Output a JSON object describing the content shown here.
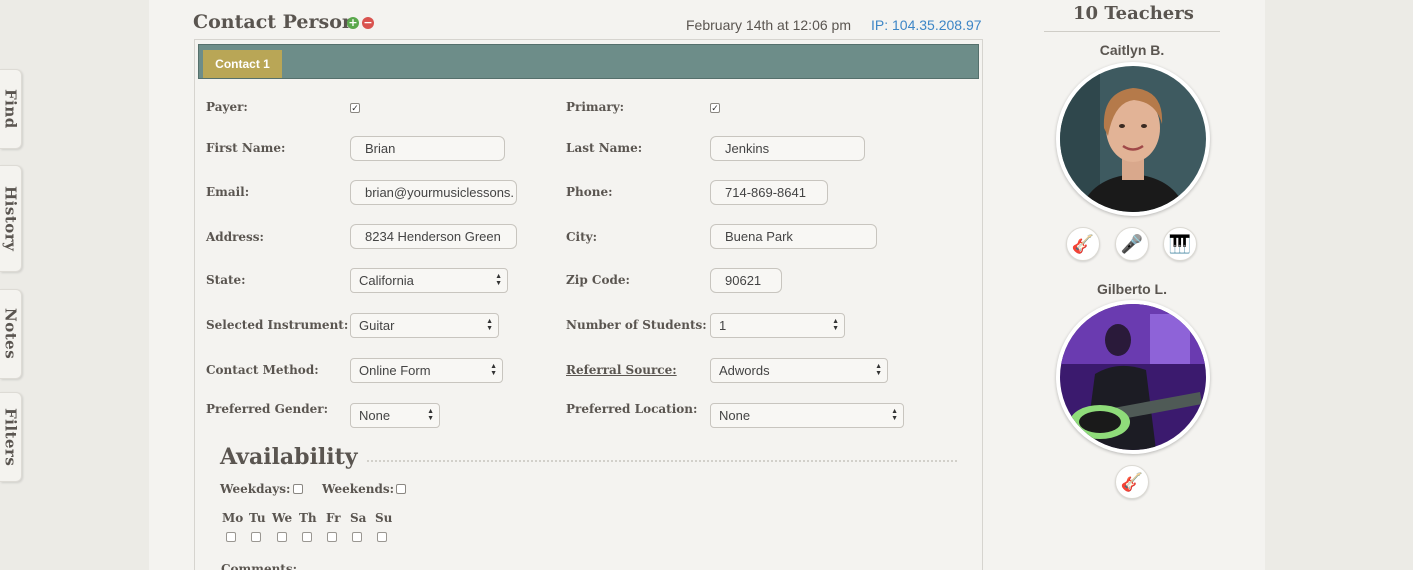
{
  "side_tabs": [
    "Find",
    "History",
    "Notes",
    "Filters"
  ],
  "header": {
    "title": "Contact Person",
    "datetime": "February 14th at 12:06 pm",
    "ip": "IP: 104.35.208.97"
  },
  "tab": {
    "label": "Contact 1"
  },
  "form": {
    "payer_label": "Payer:",
    "primary_label": "Primary:",
    "first_name_label": "First Name:",
    "first_name": "Brian",
    "last_name_label": "Last Name:",
    "last_name": "Jenkins",
    "email_label": "Email:",
    "email": "brian@yourmusiclessons.",
    "phone_label": "Phone:",
    "phone": "714-869-8641",
    "address_label": "Address:",
    "address": "8234 Henderson Green",
    "city_label": "City:",
    "city": "Buena Park",
    "state_label": "State:",
    "state": "California",
    "zip_label": "Zip Code:",
    "zip": "90621",
    "instrument_label": "Selected Instrument:",
    "instrument": "Guitar",
    "num_students_label": "Number of Students:",
    "num_students": "1",
    "contact_method_label": "Contact Method:",
    "contact_method": "Online Form",
    "referral_label": "Referral Source:",
    "referral": "Adwords",
    "gender_label": "Preferred Gender:",
    "gender": "None",
    "location_label": "Preferred Location:",
    "location": "None"
  },
  "availability": {
    "title": "Availability",
    "weekdays_label": "Weekdays:",
    "weekends_label": "Weekends:",
    "days": [
      "Mo",
      "Tu",
      "We",
      "Th",
      "Fr",
      "Sa",
      "Su"
    ],
    "comments_label": "Comments:"
  },
  "teachers": {
    "title": "10 Teachers",
    "list": [
      {
        "name": "Caitlyn B.",
        "instruments": [
          "guitar-icon",
          "microphone-icon",
          "piano-icon"
        ]
      },
      {
        "name": "Gilberto L.",
        "instruments": [
          "guitar-icon"
        ]
      }
    ]
  },
  "colors": {
    "tabbar": "#6d8d89",
    "active_tab": "#b9a656",
    "ip_link": "#3d86c6"
  }
}
